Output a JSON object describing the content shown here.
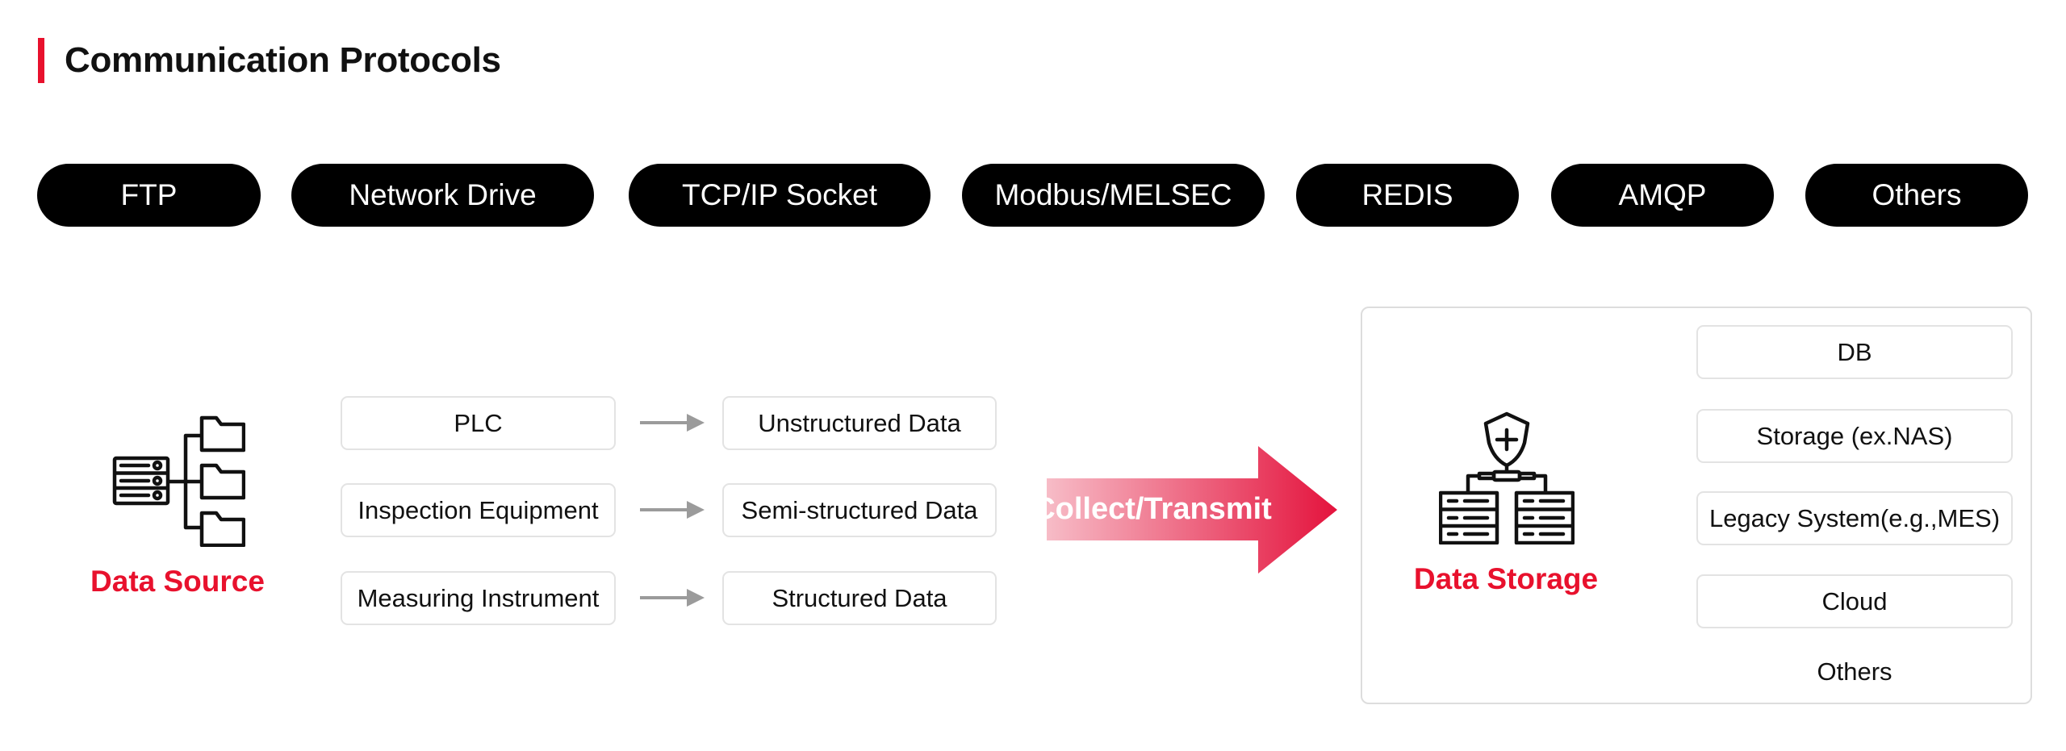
{
  "header": {
    "title": "Communication Protocols",
    "accent_color": "#e8112d"
  },
  "protocols": [
    {
      "label": "FTP"
    },
    {
      "label": "Network Drive"
    },
    {
      "label": "TCP/IP Socket"
    },
    {
      "label": "Modbus/MELSEC"
    },
    {
      "label": "REDIS"
    },
    {
      "label": "AMQP"
    },
    {
      "label": "Others"
    }
  ],
  "data_source": {
    "label": "Data Source",
    "icon": "server-folder-tree-icon",
    "sources": [
      {
        "label": "PLC"
      },
      {
        "label": "Inspection Equipment"
      },
      {
        "label": "Measuring Instrument"
      }
    ],
    "data_types": [
      {
        "label": "Unstructured Data"
      },
      {
        "label": "Semi-structured Data"
      },
      {
        "label": "Structured Data"
      }
    ],
    "arrow_icon": "arrow-right-icon"
  },
  "flow": {
    "label": "Collect/Transmit",
    "gradient_start": "#f7bcc7",
    "gradient_end": "#e4133d"
  },
  "data_storage": {
    "label": "Data Storage",
    "icon": "secure-database-icon",
    "targets": [
      {
        "label": "DB"
      },
      {
        "label": "Storage (ex.NAS)"
      },
      {
        "label": "Legacy System(e.g.,MES)"
      },
      {
        "label": "Cloud"
      }
    ],
    "others_label": "Others"
  }
}
